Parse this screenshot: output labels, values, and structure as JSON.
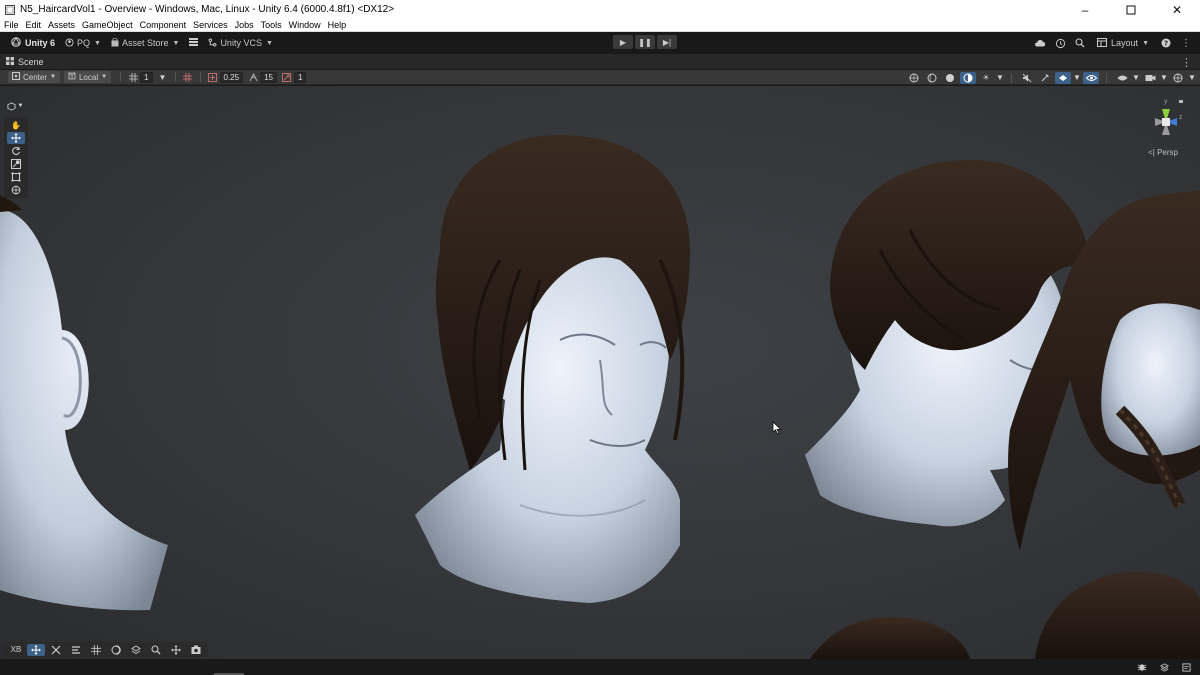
{
  "window": {
    "title": "N5_HaircardVol1 - Overview - Windows, Mac, Linux - Unity 6.4 (6000.4.8f1) <DX12>",
    "minimize_icon": "minimize-icon",
    "maximize_icon": "maximize-icon",
    "close_icon": "close-icon"
  },
  "menu": [
    "File",
    "Edit",
    "Assets",
    "GameObject",
    "Component",
    "Services",
    "Jobs",
    "Tools",
    "Window",
    "Help"
  ],
  "toolbar": {
    "unity_label": "Unity 6",
    "account_label": "PQ",
    "asset_store_label": "Asset Store",
    "vcs_label": "Unity VCS",
    "layout_label": "Layout"
  },
  "scene_tab": {
    "label": "Scene"
  },
  "scene_toolbar": {
    "pivot_label": "Center",
    "space_label": "Local",
    "grid_value": "1",
    "snap_value": "0.25",
    "rotate_snap_value": "15",
    "scale_snap_value": "1"
  },
  "viewport": {
    "projection_label": "Persp",
    "gizmo_y": "y",
    "gizmo_z": "z"
  },
  "bottom_overlay": {
    "xr_label": "XB"
  },
  "colors": {
    "accent": "#3d6189",
    "viewport_bg": "#36383b",
    "skin": "#c9d3e1",
    "hair": "#2a1f18"
  }
}
